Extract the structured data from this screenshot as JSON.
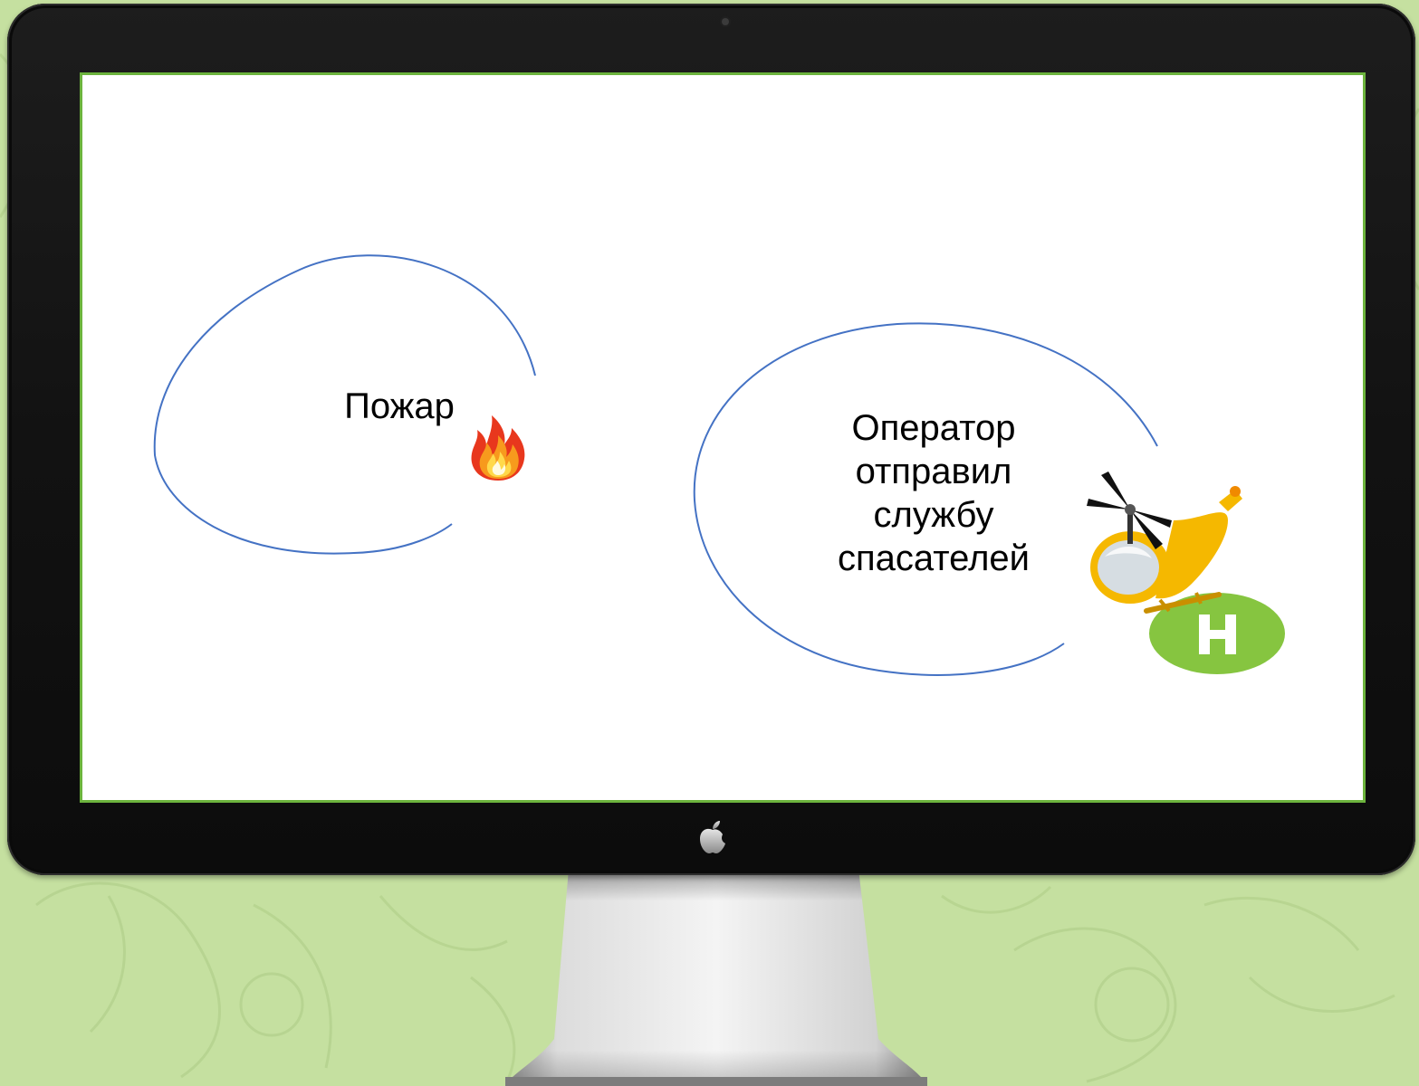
{
  "slide": {
    "fire_label": "Пожар",
    "operator_label": "Оператор\nотправил\nслужбу\nспасателей"
  },
  "icons": {
    "fire": "fire-icon",
    "helicopter": "helicopter-icon",
    "helipad": "helipad-icon",
    "apple": "apple-logo-icon",
    "camera": "camera-icon"
  },
  "colors": {
    "background": "#c5e0a0",
    "bezel": "#141414",
    "screen": "#ffffff",
    "screen_border": "#6cb33d",
    "bubble_outline": "#4472c4",
    "helipad": "#86c540",
    "helicopter_body": "#f5b800"
  }
}
